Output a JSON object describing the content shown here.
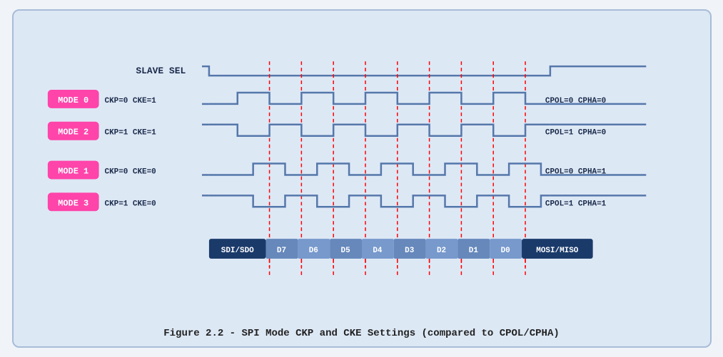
{
  "caption": "Figure 2.2 - SPI Mode CKP and CKE Settings (compared to CPOL/CPHA)",
  "diagram": {
    "slave_sel_label": "SLAVE SEL",
    "modes": [
      {
        "label": "MODE 0",
        "ckp_cke": "CKP=0  CKE=1",
        "cpol_cpha": "CPOL=0  CPHA=0"
      },
      {
        "label": "MODE 2",
        "ckp_cke": "CKP=1  CKE=1",
        "cpol_cpha": "CPOL=1  CPHA=0"
      },
      {
        "label": "MODE 1",
        "ckp_cke": "CKP=0  CKE=0",
        "cpol_cpha": "CPOL=0  CPHA=1"
      },
      {
        "label": "MODE 3",
        "ckp_cke": "CKP=1  CKE=0",
        "cpol_cpha": "CPOL=1  CPHA=1"
      }
    ],
    "data_bits": [
      "SDI/SDO",
      "D7",
      "D6",
      "D5",
      "D4",
      "D3",
      "D2",
      "D1",
      "D0",
      "MOSI/MISO"
    ]
  }
}
